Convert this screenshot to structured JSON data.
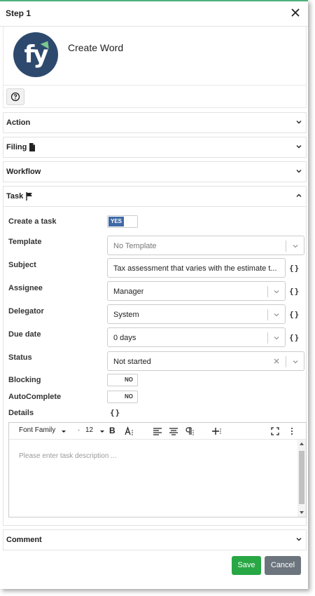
{
  "header": {
    "title": "Step 1",
    "close_icon": "close-icon"
  },
  "component": {
    "name": "Create Word",
    "logo_text": "fy",
    "logo_color": "#2d4a6e"
  },
  "help": {
    "icon": "question-circle-icon"
  },
  "sections": {
    "action": {
      "label": "Action"
    },
    "filing": {
      "label": "Filing",
      "icon": "document-icon"
    },
    "workflow": {
      "label": "Workflow"
    },
    "task": {
      "label": "Task",
      "icon": "flag-icon"
    },
    "comment": {
      "label": "Comment"
    }
  },
  "task": {
    "create_task": {
      "label": "Create a task",
      "value": "YES"
    },
    "template": {
      "label": "Template",
      "placeholder": "No Template"
    },
    "subject": {
      "label": "Subject",
      "value": "Tax assessment that varies with the estimate t..."
    },
    "assignee": {
      "label": "Assignee",
      "value": "Manager"
    },
    "delegator": {
      "label": "Delegator",
      "value": "System"
    },
    "due_date": {
      "label": "Due date",
      "value": "0 days"
    },
    "status": {
      "label": "Status",
      "value": "Not started"
    },
    "blocking": {
      "label": "Blocking",
      "value": "NO"
    },
    "autocomplete": {
      "label": "AutoComplete",
      "value": "NO"
    },
    "details": {
      "label": "Details"
    },
    "braces": "{}"
  },
  "editor": {
    "font_family": "Font Family",
    "font_size": "12",
    "bold": "B",
    "placeholder": "Please enter task description ..."
  },
  "footer": {
    "save_label": "Save",
    "cancel_label": "Cancel"
  },
  "colors": {
    "accent_top": "#4caf7d",
    "toggle_on": "#3f6aa6",
    "save": "#28a745",
    "cancel": "#6c757d"
  }
}
